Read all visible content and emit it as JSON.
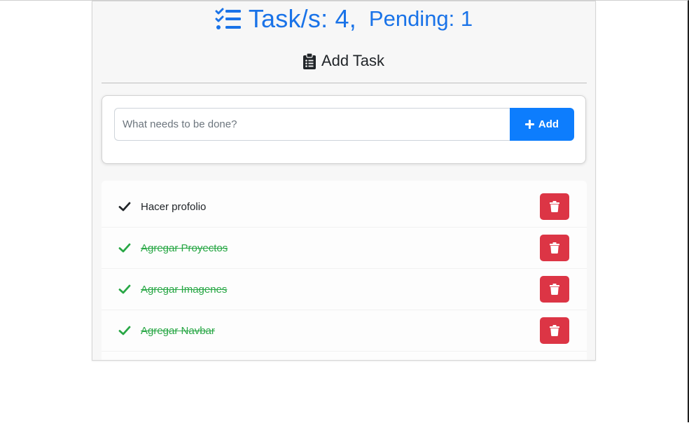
{
  "header": {
    "tasks_label": "Task/s: 4,",
    "pending_label": "Pending: 1",
    "icon": "list-check-icon"
  },
  "section": {
    "title": "Add Task",
    "icon": "clipboard-list-icon"
  },
  "form": {
    "input_placeholder": "What needs to be done?",
    "input_value": "",
    "add_label": "Add",
    "add_icon": "plus-icon"
  },
  "tasks": [
    {
      "text": "Hacer profolio",
      "completed": false
    },
    {
      "text": "Agregar Proyectos",
      "completed": true
    },
    {
      "text": "Agregar Imagenes",
      "completed": true
    },
    {
      "text": "Agregar Navbar",
      "completed": true
    }
  ],
  "colors": {
    "primary": "#1a73e8",
    "add_button": "#0d7dfd",
    "danger": "#dc3545",
    "success": "#28a745",
    "text": "#212529"
  }
}
